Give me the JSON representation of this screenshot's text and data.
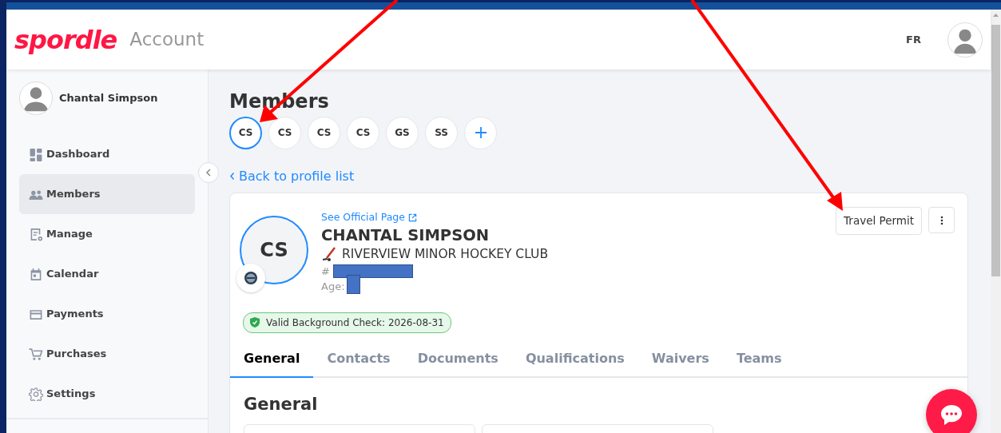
{
  "header": {
    "logo": "spordle",
    "title": "Account",
    "language": "FR"
  },
  "sidebar": {
    "user": "Chantal Simpson",
    "items": [
      {
        "label": "Dashboard",
        "selected": false
      },
      {
        "label": "Members",
        "selected": true
      },
      {
        "label": "Manage",
        "selected": false
      },
      {
        "label": "Calendar",
        "selected": false
      },
      {
        "label": "Payments",
        "selected": false
      },
      {
        "label": "Purchases",
        "selected": false
      },
      {
        "label": "Settings",
        "selected": false
      }
    ]
  },
  "page": {
    "title": "Members",
    "members": [
      {
        "initials": "CS",
        "selected": true
      },
      {
        "initials": "CS",
        "selected": false
      },
      {
        "initials": "CS",
        "selected": false
      },
      {
        "initials": "CS",
        "selected": false
      },
      {
        "initials": "GS",
        "selected": false
      },
      {
        "initials": "SS",
        "selected": false
      }
    ],
    "back_link": "Back to profile list"
  },
  "profile": {
    "official_link": "See Official Page",
    "initials": "CS",
    "name": "CHANTAL SIMPSON",
    "club": "RIVERVIEW MINOR HOCKEY CLUB",
    "number_label": "#",
    "age_label": "Age:",
    "action": "Travel Permit",
    "badge": "Valid Background Check: 2026-08-31"
  },
  "tabs": [
    {
      "label": "General",
      "selected": true
    },
    {
      "label": "Contacts",
      "selected": false
    },
    {
      "label": "Documents",
      "selected": false
    },
    {
      "label": "Qualifications",
      "selected": false
    },
    {
      "label": "Waivers",
      "selected": false
    },
    {
      "label": "Teams",
      "selected": false
    }
  ],
  "section_title": "General"
}
